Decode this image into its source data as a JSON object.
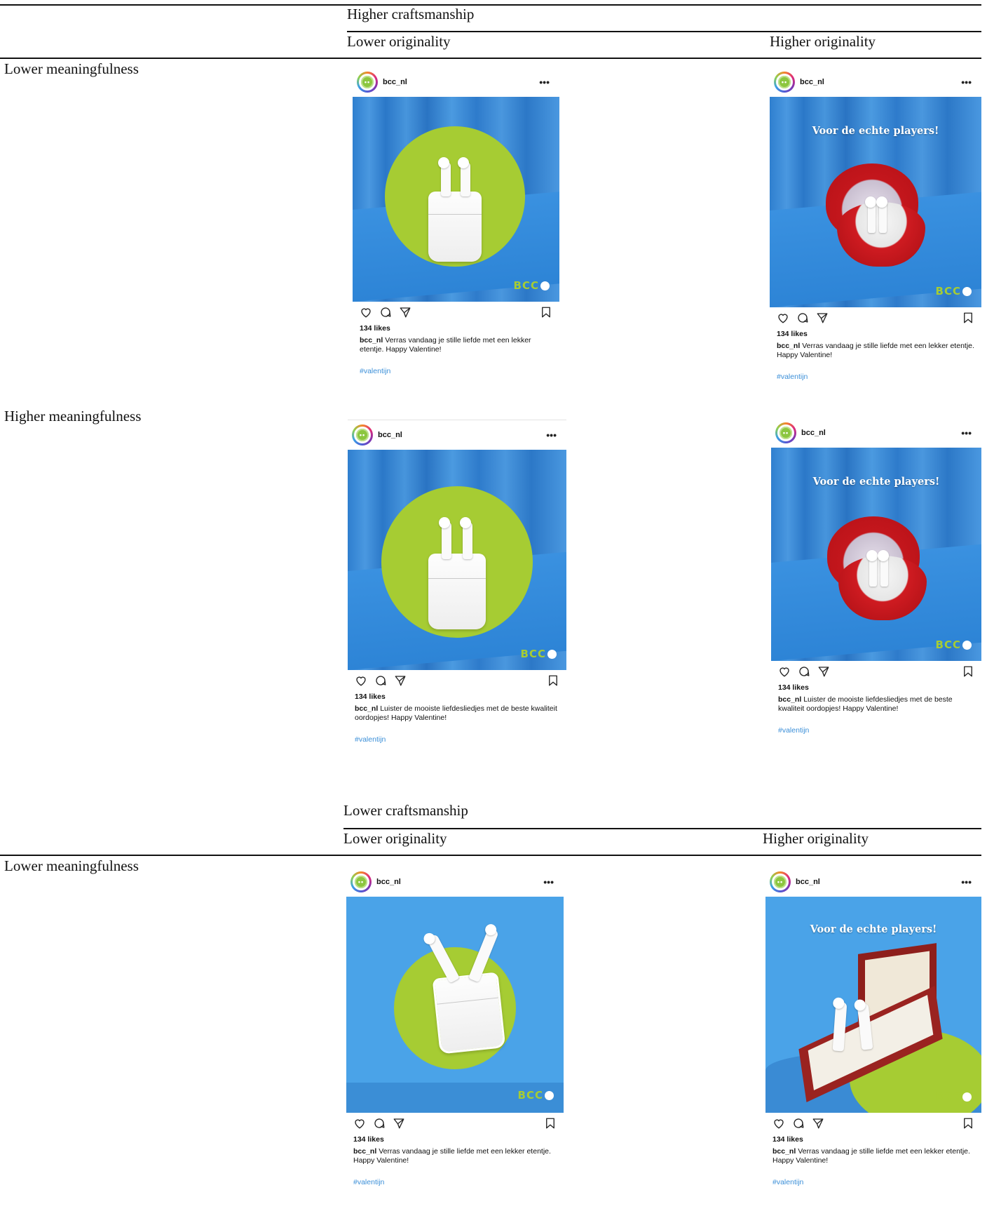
{
  "panels": [
    {
      "craftsmanship": "Higher craftsmanship",
      "originality_low": "Lower originality",
      "originality_high": "Higher originality",
      "rows": [
        {
          "label": "Lower meaningfulness"
        },
        {
          "label": "Higher meaningfulness"
        }
      ]
    },
    {
      "craftsmanship": "Lower craftsmanship",
      "originality_low": "Lower originality",
      "originality_high": "Higher originality",
      "rows": [
        {
          "label": "Lower meaningfulness"
        }
      ]
    }
  ],
  "post": {
    "username": "bcc_nl",
    "more": "•••",
    "brand": "BCC",
    "slogan": "Voor de echte players!",
    "likes": "134 likes",
    "caption_user": "bcc_nl",
    "caption_low_meaning": "Verras vandaag je stille liefde met een lekker etentje. Happy Valentine!",
    "caption_high_meaning": "Luister de mooiste liefdesliedjes met de beste kwaliteit oordopjes! Happy Valentine!",
    "hashtag": "#valentijn"
  },
  "colors": {
    "brand_green": "#a6cc33",
    "photo_blue": "#2f7fcf",
    "hashtag_blue": "#3b8fd8",
    "ring_red": "#c4161c"
  }
}
